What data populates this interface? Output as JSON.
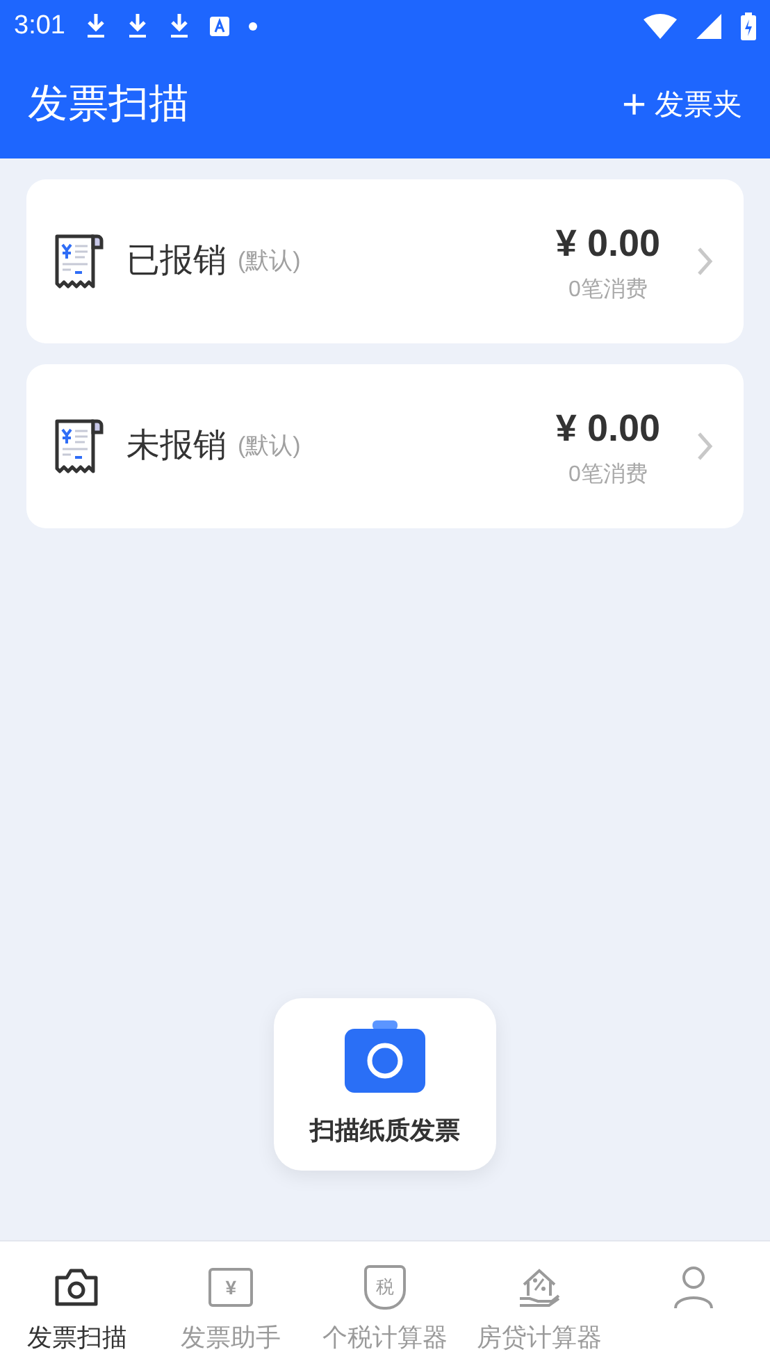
{
  "status_bar": {
    "time": "3:01"
  },
  "header": {
    "title": "发票扫描",
    "action": "发票夹",
    "action_icon": "+"
  },
  "folders": [
    {
      "name": "已报销",
      "tag": "(默认)",
      "amount": "¥ 0.00",
      "count": "0笔消费"
    },
    {
      "name": "未报销",
      "tag": "(默认)",
      "amount": "¥ 0.00",
      "count": "0笔消费"
    }
  ],
  "scan_button": {
    "label": "扫描纸质发票"
  },
  "tabs": [
    {
      "kind": "camera",
      "label": "发票扫描",
      "selected": true
    },
    {
      "kind": "ticket",
      "label": "发票助手",
      "icon_text": "¥",
      "selected": false
    },
    {
      "kind": "shield",
      "label": "个税计算器",
      "icon_text": "税",
      "selected": false
    },
    {
      "kind": "house",
      "label": "房贷计算器",
      "selected": false
    },
    {
      "kind": "person",
      "selected": false
    }
  ]
}
